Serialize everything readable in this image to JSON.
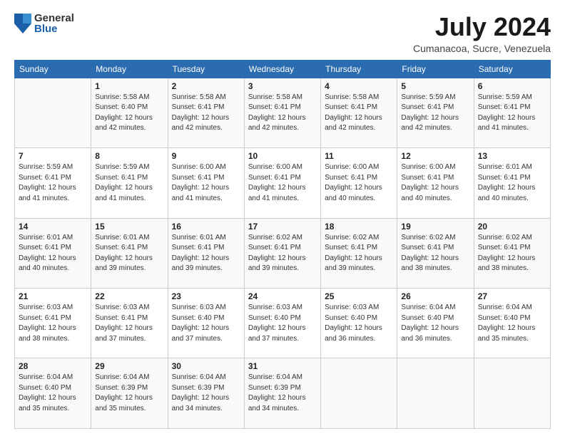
{
  "logo": {
    "general": "General",
    "blue": "Blue"
  },
  "title": "July 2024",
  "subtitle": "Cumanacoa, Sucre, Venezuela",
  "days_of_week": [
    "Sunday",
    "Monday",
    "Tuesday",
    "Wednesday",
    "Thursday",
    "Friday",
    "Saturday"
  ],
  "weeks": [
    [
      {
        "day": "",
        "info": ""
      },
      {
        "day": "1",
        "info": "Sunrise: 5:58 AM\nSunset: 6:40 PM\nDaylight: 12 hours\nand 42 minutes."
      },
      {
        "day": "2",
        "info": "Sunrise: 5:58 AM\nSunset: 6:41 PM\nDaylight: 12 hours\nand 42 minutes."
      },
      {
        "day": "3",
        "info": "Sunrise: 5:58 AM\nSunset: 6:41 PM\nDaylight: 12 hours\nand 42 minutes."
      },
      {
        "day": "4",
        "info": "Sunrise: 5:58 AM\nSunset: 6:41 PM\nDaylight: 12 hours\nand 42 minutes."
      },
      {
        "day": "5",
        "info": "Sunrise: 5:59 AM\nSunset: 6:41 PM\nDaylight: 12 hours\nand 42 minutes."
      },
      {
        "day": "6",
        "info": "Sunrise: 5:59 AM\nSunset: 6:41 PM\nDaylight: 12 hours\nand 41 minutes."
      }
    ],
    [
      {
        "day": "7",
        "info": "Sunrise: 5:59 AM\nSunset: 6:41 PM\nDaylight: 12 hours\nand 41 minutes."
      },
      {
        "day": "8",
        "info": "Sunrise: 5:59 AM\nSunset: 6:41 PM\nDaylight: 12 hours\nand 41 minutes."
      },
      {
        "day": "9",
        "info": "Sunrise: 6:00 AM\nSunset: 6:41 PM\nDaylight: 12 hours\nand 41 minutes."
      },
      {
        "day": "10",
        "info": "Sunrise: 6:00 AM\nSunset: 6:41 PM\nDaylight: 12 hours\nand 41 minutes."
      },
      {
        "day": "11",
        "info": "Sunrise: 6:00 AM\nSunset: 6:41 PM\nDaylight: 12 hours\nand 40 minutes."
      },
      {
        "day": "12",
        "info": "Sunrise: 6:00 AM\nSunset: 6:41 PM\nDaylight: 12 hours\nand 40 minutes."
      },
      {
        "day": "13",
        "info": "Sunrise: 6:01 AM\nSunset: 6:41 PM\nDaylight: 12 hours\nand 40 minutes."
      }
    ],
    [
      {
        "day": "14",
        "info": "Sunrise: 6:01 AM\nSunset: 6:41 PM\nDaylight: 12 hours\nand 40 minutes."
      },
      {
        "day": "15",
        "info": "Sunrise: 6:01 AM\nSunset: 6:41 PM\nDaylight: 12 hours\nand 39 minutes."
      },
      {
        "day": "16",
        "info": "Sunrise: 6:01 AM\nSunset: 6:41 PM\nDaylight: 12 hours\nand 39 minutes."
      },
      {
        "day": "17",
        "info": "Sunrise: 6:02 AM\nSunset: 6:41 PM\nDaylight: 12 hours\nand 39 minutes."
      },
      {
        "day": "18",
        "info": "Sunrise: 6:02 AM\nSunset: 6:41 PM\nDaylight: 12 hours\nand 39 minutes."
      },
      {
        "day": "19",
        "info": "Sunrise: 6:02 AM\nSunset: 6:41 PM\nDaylight: 12 hours\nand 38 minutes."
      },
      {
        "day": "20",
        "info": "Sunrise: 6:02 AM\nSunset: 6:41 PM\nDaylight: 12 hours\nand 38 minutes."
      }
    ],
    [
      {
        "day": "21",
        "info": "Sunrise: 6:03 AM\nSunset: 6:41 PM\nDaylight: 12 hours\nand 38 minutes."
      },
      {
        "day": "22",
        "info": "Sunrise: 6:03 AM\nSunset: 6:41 PM\nDaylight: 12 hours\nand 37 minutes."
      },
      {
        "day": "23",
        "info": "Sunrise: 6:03 AM\nSunset: 6:40 PM\nDaylight: 12 hours\nand 37 minutes."
      },
      {
        "day": "24",
        "info": "Sunrise: 6:03 AM\nSunset: 6:40 PM\nDaylight: 12 hours\nand 37 minutes."
      },
      {
        "day": "25",
        "info": "Sunrise: 6:03 AM\nSunset: 6:40 PM\nDaylight: 12 hours\nand 36 minutes."
      },
      {
        "day": "26",
        "info": "Sunrise: 6:04 AM\nSunset: 6:40 PM\nDaylight: 12 hours\nand 36 minutes."
      },
      {
        "day": "27",
        "info": "Sunrise: 6:04 AM\nSunset: 6:40 PM\nDaylight: 12 hours\nand 35 minutes."
      }
    ],
    [
      {
        "day": "28",
        "info": "Sunrise: 6:04 AM\nSunset: 6:40 PM\nDaylight: 12 hours\nand 35 minutes."
      },
      {
        "day": "29",
        "info": "Sunrise: 6:04 AM\nSunset: 6:39 PM\nDaylight: 12 hours\nand 35 minutes."
      },
      {
        "day": "30",
        "info": "Sunrise: 6:04 AM\nSunset: 6:39 PM\nDaylight: 12 hours\nand 34 minutes."
      },
      {
        "day": "31",
        "info": "Sunrise: 6:04 AM\nSunset: 6:39 PM\nDaylight: 12 hours\nand 34 minutes."
      },
      {
        "day": "",
        "info": ""
      },
      {
        "day": "",
        "info": ""
      },
      {
        "day": "",
        "info": ""
      }
    ]
  ]
}
